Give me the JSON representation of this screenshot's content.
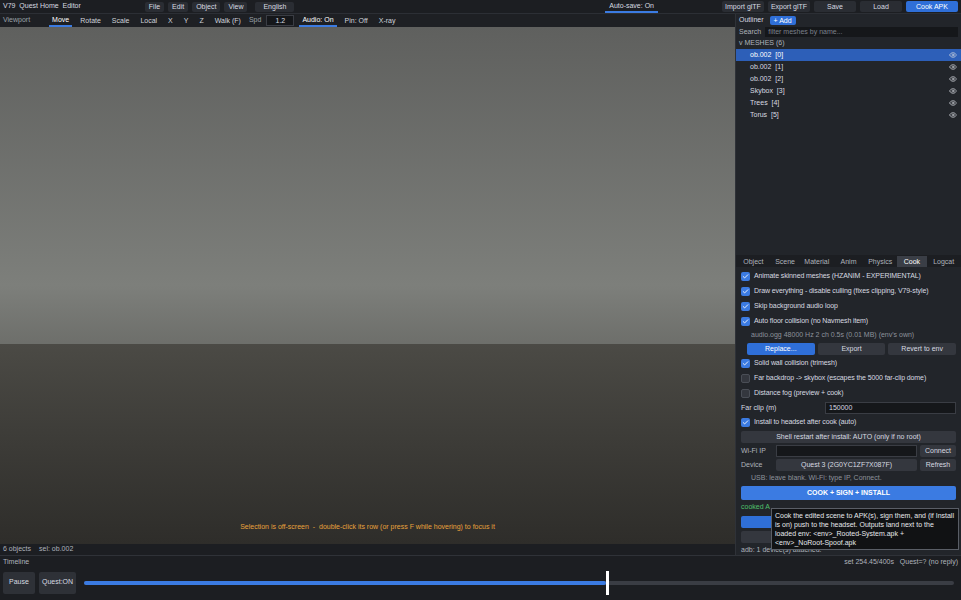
{
  "app": {
    "title": "V79  Quest Home  Editor",
    "menu": [
      "File",
      "Edit",
      "Object",
      "View"
    ],
    "language": "English",
    "autosave": {
      "label": "Auto-save: On",
      "selected": true
    },
    "buttons": [
      {
        "label": "Import glTF",
        "selected": false
      },
      {
        "label": "Export glTF",
        "selected": false
      },
      {
        "label": "Save",
        "selected": false
      },
      {
        "label": "Load",
        "selected": false
      },
      {
        "label": "Cook APK",
        "selected": true
      }
    ]
  },
  "viewport_toolbar": [
    {
      "kind": "label",
      "label": "Viewport",
      "selected": false
    },
    {
      "kind": "tool",
      "label": "Move",
      "selected": true
    },
    {
      "kind": "tool",
      "label": "Rotate",
      "selected": false
    },
    {
      "kind": "tool",
      "label": "Scale",
      "selected": false
    },
    {
      "kind": "tool",
      "label": "Local",
      "selected": false
    },
    {
      "kind": "tool",
      "label": "X",
      "selected": false
    },
    {
      "kind": "tool",
      "label": "Y",
      "selected": false
    },
    {
      "kind": "tool",
      "label": "Z",
      "selected": false
    },
    {
      "kind": "tool",
      "label": "Walk (F)",
      "selected": false
    },
    {
      "kind": "label",
      "label": "Spd",
      "selected": false
    },
    {
      "kind": "input",
      "label": "1.2",
      "selected": false
    },
    {
      "kind": "tool",
      "label": "Audio: On",
      "selected": true
    },
    {
      "kind": "tool",
      "label": "Pin: Off",
      "selected": false
    },
    {
      "kind": "tool",
      "label": "X-ray",
      "selected": false
    }
  ],
  "viewport": {
    "hint": "Selection is off-screen  -  double-click its row (or press F while hovering) to focus it"
  },
  "status_bar": {
    "objects": "6 objects",
    "selection": "sel: ob.002"
  },
  "outliner": {
    "title": "Outliner",
    "add_button": "+ Add",
    "search_label": "Search",
    "search_placeholder": "filter meshes by name...",
    "group": "v MESHES (6)",
    "items": [
      {
        "name": "ob.002  [0]",
        "selected": true,
        "visible": true
      },
      {
        "name": "ob.002  [1]",
        "selected": false,
        "visible": true
      },
      {
        "name": "ob.002  [2]",
        "selected": false,
        "visible": true
      },
      {
        "name": "Skybox  [3]",
        "selected": false,
        "visible": true
      },
      {
        "name": "Trees  [4]",
        "selected": false,
        "visible": true
      },
      {
        "name": "Torus  [5]",
        "selected": false,
        "visible": true
      }
    ]
  },
  "properties": {
    "tabs": [
      {
        "label": "Object",
        "selected": false
      },
      {
        "label": "Scene",
        "selected": false
      },
      {
        "label": "Material",
        "selected": false
      },
      {
        "label": "Anim",
        "selected": false
      },
      {
        "label": "Physics",
        "selected": false
      },
      {
        "label": "Cook",
        "selected": true
      },
      {
        "label": "Logcat",
        "selected": false
      }
    ],
    "rows": [
      {
        "kind": "checkbox",
        "label": "Animate skinned meshes (HZANIM - EXPERIMENTAL)",
        "checked": true
      },
      {
        "kind": "checkbox",
        "label": "Draw everything - disable culling (fixes clipping, V79-style)",
        "checked": true
      },
      {
        "kind": "checkbox",
        "label": "Skip background audio loop",
        "checked": true
      },
      {
        "kind": "checkbox",
        "label": "Auto floor collision (no Navmesh item)",
        "checked": true
      },
      {
        "kind": "info",
        "label": "audio.ogg  48000 Hz  2 ch  0.5s  (0.01 MB)  (env's own)"
      },
      {
        "kind": "buttons",
        "buttons": [
          {
            "label": "Replace...",
            "primary": true
          },
          {
            "label": "Export",
            "primary": false
          },
          {
            "label": "Revert to env",
            "primary": false
          }
        ]
      },
      {
        "kind": "checkbox",
        "label": "Solid wall collision (trimesh)",
        "checked": true
      },
      {
        "kind": "checkbox",
        "label": "Far backdrop -> skybox (escapes the 5000 far-clip dome)",
        "checked": false
      },
      {
        "kind": "checkbox",
        "label": "Distance fog (preview + cook)",
        "checked": false
      },
      {
        "kind": "field",
        "label": "Far clip (m)",
        "value": "150000"
      },
      {
        "kind": "checkbox",
        "label": "Install to headset after cook (auto)",
        "checked": true
      },
      {
        "kind": "wide-button",
        "label": "Shell restart after install: AUTO (only if no root)",
        "primary": false
      },
      {
        "kind": "field-button",
        "label": "Wi-Fi IP",
        "button": "Connect"
      },
      {
        "kind": "select-button",
        "label": "Device",
        "value": "Quest 3  (2G0YC1ZF7X087F)",
        "button": "Refresh"
      },
      {
        "kind": "info",
        "label": "USB: leave blank. Wi-Fi: type IP, Connect."
      },
      {
        "kind": "wide-button",
        "label": "COOK + SIGN + INSTALL",
        "primary": true
      }
    ],
    "cook_status": "cooked A",
    "footer": "adb: 1 device(s) attached."
  },
  "tooltip": {
    "text": "Cook the edited scene to APK(s), sign them, and (if Install is on) push to the headset. Outputs land next to the loaded env:  <env>_Rooted-System.apk  +  <env>_NoRoot-Spoof.apk"
  },
  "timeline": {
    "title": "Timeline",
    "buttons": [
      "Pause",
      "Quest:ON"
    ],
    "level": 0.6,
    "status": "set 254.45/400s   Quest=? (no reply)"
  }
}
